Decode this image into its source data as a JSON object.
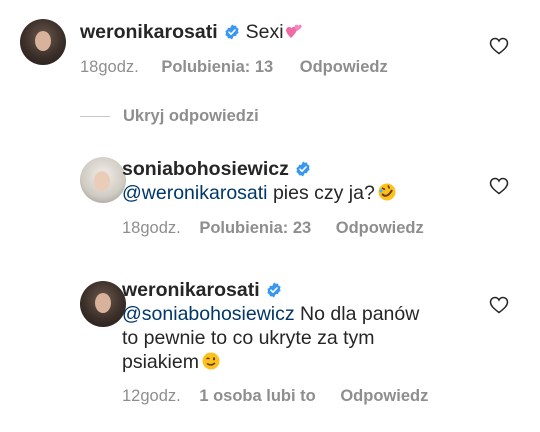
{
  "comments": [
    {
      "username": "weronikarosati",
      "text": "Sexi",
      "emoji_icon": "two-hearts-emoji",
      "time": "18godz.",
      "likes": "Polubienia: 13",
      "reply": "Odpowiedz"
    },
    {
      "username": "soniabohosiewicz",
      "mention": "@weronikarosati",
      "text": " pies czy ja?",
      "emoji_icon": "rolling-on-floor-laughing-emoji",
      "time": "18godz.",
      "likes": "Polubienia: 23",
      "reply": "Odpowiedz"
    },
    {
      "username": "weronikarosati",
      "mention": "@soniabohosiewicz",
      "text_line1": " No dla panów",
      "text_line2": "to pewnie to co ukryte za tym",
      "text_line3": "psiakiem",
      "emoji_icon": "winking-face-emoji",
      "time": "12godz.",
      "likes": "1 osoba lubi to",
      "reply": "Odpowiedz"
    }
  ],
  "hide_replies": "Ukryj odpowiedzi",
  "colors": {
    "text": "#262626",
    "meta": "#8e8e8e",
    "mention": "#00376b",
    "verified": "#3897f0"
  }
}
